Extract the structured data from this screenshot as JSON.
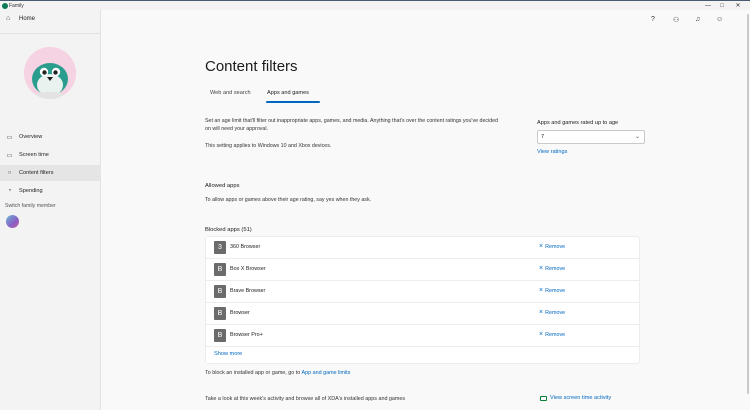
{
  "window": {
    "title": "Family",
    "controls": {
      "minimize": "—",
      "maximize": "□",
      "close": "✕"
    }
  },
  "topbar": {
    "icons": [
      "help-icon",
      "family-settings-icon",
      "notifications-icon",
      "account-icon"
    ],
    "glyphs": {
      "help": "?",
      "family": "⚇",
      "bell": "♫",
      "account": "☺"
    }
  },
  "sidebar": {
    "home_label": "Home",
    "items": [
      {
        "label": "Overview",
        "icon": "overview-icon"
      },
      {
        "label": "Screen time",
        "icon": "screen-time-icon"
      },
      {
        "label": "Content filters",
        "icon": "content-filters-icon",
        "selected": true
      },
      {
        "label": "Spending",
        "icon": "spending-icon"
      }
    ],
    "switch_label": "Switch family member"
  },
  "main": {
    "title": "Content filters",
    "tabs": [
      {
        "label": "Web and search"
      },
      {
        "label": "Apps and games",
        "active": true
      }
    ],
    "description_1": "Set an age limit that'll filter out inappropriate apps, games, and media. Anything that's over the content ratings you've decided on will need your approval.",
    "description_2": "This setting applies to Windows 10 and Xbox devices.",
    "rating": {
      "label": "Apps and games rated up to age",
      "value": "7",
      "view_ratings": "View ratings"
    },
    "allowed": {
      "title": "Allowed apps",
      "text": "To allow apps or games above their age rating, say yes when they ask."
    },
    "blocked": {
      "title": "Blocked apps (51)",
      "rows": [
        {
          "letter": "3",
          "name": "360 Browser",
          "action": "Remove"
        },
        {
          "letter": "B",
          "name": "Box X Browser",
          "action": "Remove"
        },
        {
          "letter": "B",
          "name": "Brave Browser",
          "action": "Remove"
        },
        {
          "letter": "B",
          "name": "Browser",
          "action": "Remove"
        },
        {
          "letter": "B",
          "name": "Browser Pro+",
          "action": "Remove"
        }
      ],
      "show_more": "Show more"
    },
    "block_hint": {
      "prefix": "To block an installed app or game, go to ",
      "link": "App and game limits"
    },
    "activity": {
      "text": "Take a look at this week's activity and browse all of XDA's installed apps and games",
      "link": "View screen time activity"
    }
  },
  "colors": {
    "accent": "#0067c0",
    "selected_nav": "#e5e5e5",
    "avatar_bg": "#f6d3e3"
  }
}
